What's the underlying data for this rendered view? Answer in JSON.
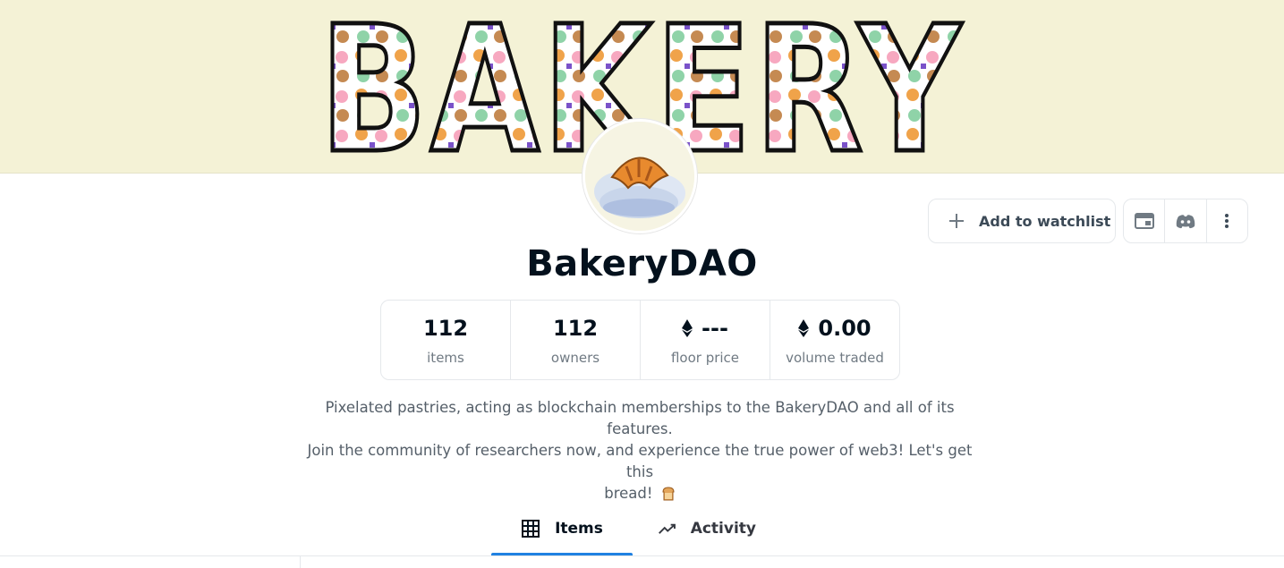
{
  "banner": {
    "text": "BAKERY"
  },
  "collection": {
    "name": "BakeryDAO",
    "description_line1": "Pixelated pastries, acting as blockchain memberships to the BakeryDAO and all of its features.",
    "description_line2": "Join the community of researchers now, and experience the true power of web3! Let's get this",
    "description_line3": "bread!"
  },
  "actions": {
    "watchlist_label": "Add to watchlist",
    "icons": [
      "website-icon",
      "discord-icon",
      "more-icon"
    ]
  },
  "stats": [
    {
      "value": "112",
      "label": "items",
      "eth": false
    },
    {
      "value": "112",
      "label": "owners",
      "eth": false
    },
    {
      "value": "---",
      "label": "floor price",
      "eth": true
    },
    {
      "value": "0.00",
      "label": "volume traded",
      "eth": true
    }
  ],
  "tabs": [
    {
      "label": "Items",
      "icon": "grid-icon",
      "active": true
    },
    {
      "label": "Activity",
      "icon": "activity-chart-icon",
      "active": false
    }
  ],
  "colors": {
    "banner_bg": "#f4f2d6",
    "accent": "#2081e2",
    "text": "#04111d",
    "muted": "#707a83"
  }
}
